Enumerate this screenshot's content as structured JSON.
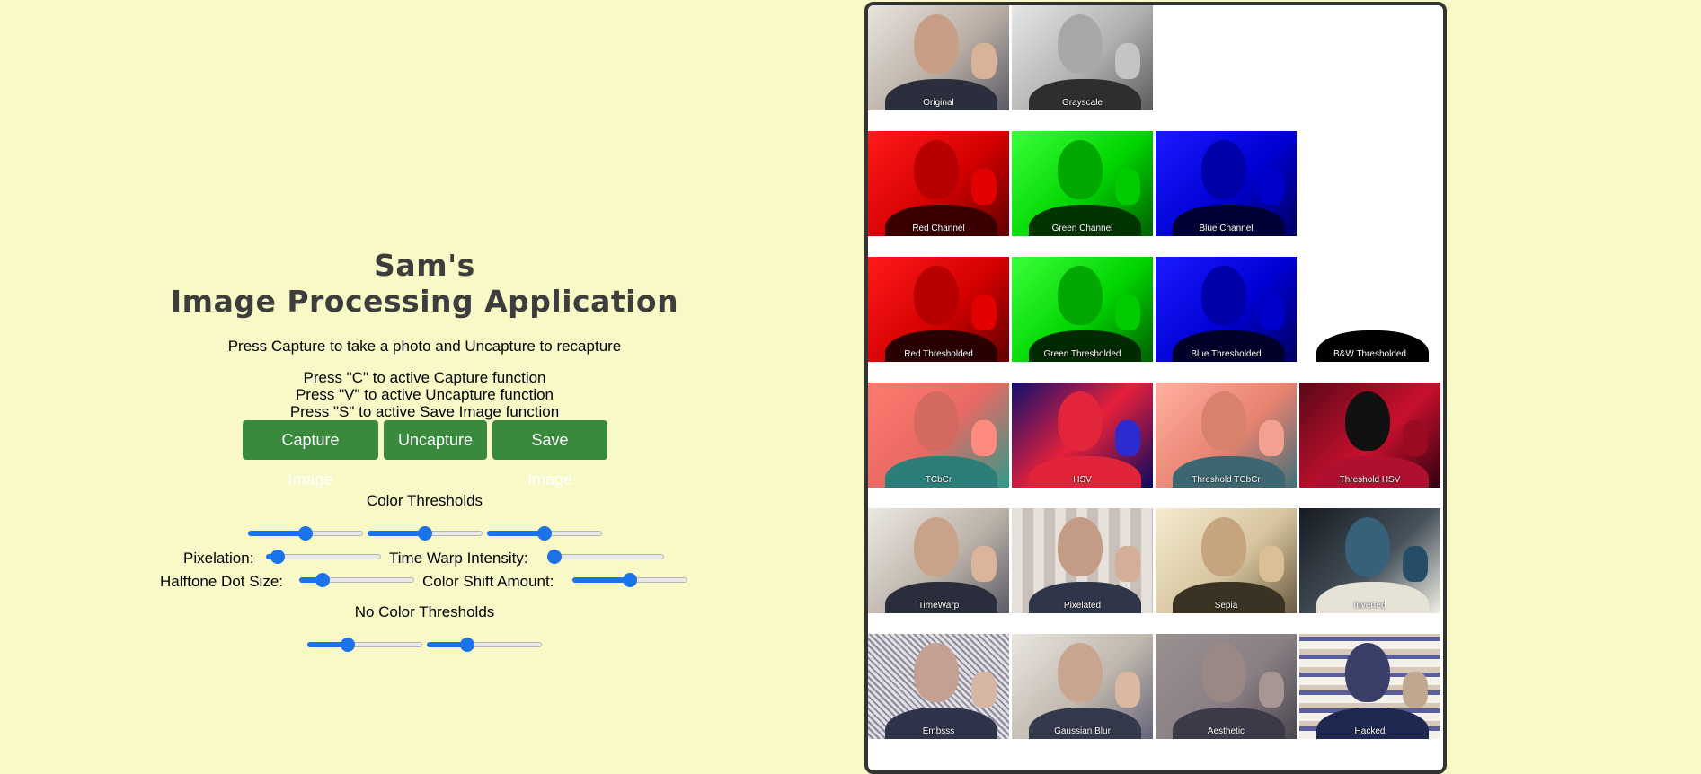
{
  "title": {
    "line1": "Sam's",
    "line2": "Image Processing Application"
  },
  "instructions": {
    "main": "Press Capture to take a photo and Uncapture to recapture",
    "key_c": "Press \"C\" to active Capture function",
    "key_v": "Press \"V\" to active Uncapture function",
    "key_s": "Press \"S\" to active Save Image function"
  },
  "buttons": {
    "capture": "Capture Image",
    "uncapture": "Uncapture",
    "save": "Save Image"
  },
  "color_thresholds": {
    "label": "Color Thresholds",
    "values": [
      0.5,
      0.5,
      0.5
    ]
  },
  "pixelation": {
    "label": "Pixelation:",
    "value": 0.1
  },
  "time_warp": {
    "label": "Time Warp Intensity:",
    "value": 0.05
  },
  "halftone": {
    "label": "Halftone Dot Size:",
    "value": 0.2
  },
  "color_shift": {
    "label": "Color Shift Amount:",
    "value": 0.5
  },
  "no_color_thresholds": {
    "label": "No Color Thresholds",
    "values": [
      0.35,
      0.35
    ]
  },
  "colors": {
    "background": "#f9f9c8",
    "button": "#3a8a3e",
    "slider": "#1a73e8"
  },
  "gallery": [
    [
      "Original",
      "Grayscale"
    ],
    [
      "Red Channel",
      "Green Channel",
      "Blue Channel"
    ],
    [
      "Red Thresholded",
      "Green Thresholded",
      "Blue Thresholded",
      "B&W Thresholded"
    ],
    [
      "TCbCr",
      "HSV",
      "Threshold TCbCr",
      "Threshold HSV"
    ],
    [
      "TimeWarp",
      "Pixelated",
      "Sepia",
      "Inverted"
    ],
    [
      "Embsss",
      "Gaussian Blur",
      "Aesthetic",
      "Hacked"
    ]
  ]
}
